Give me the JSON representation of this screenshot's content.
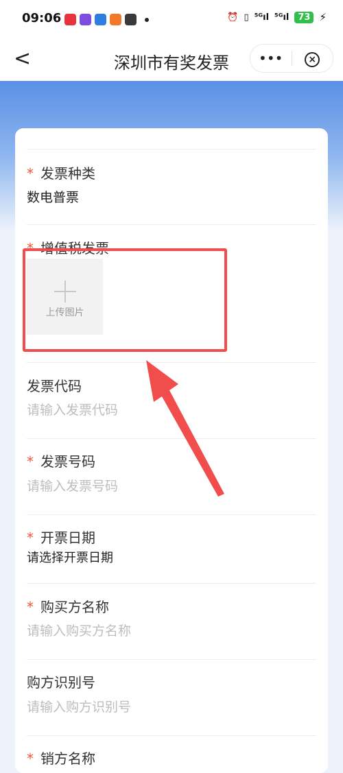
{
  "status_bar": {
    "time": "09:06",
    "signal1": "⁵ᴳıl",
    "signal2": "⁵ᴳıl",
    "battery": "73"
  },
  "nav": {
    "title": "深圳市有奖发票",
    "more_label": "•••",
    "close_label": "×"
  },
  "form": {
    "invoice_type": {
      "label": "发票种类",
      "value": "数电普票"
    },
    "vat_invoice": {
      "label": "增值税发票",
      "upload_label": "上传图片"
    },
    "invoice_code": {
      "label": "发票代码",
      "placeholder": "请输入发票代码"
    },
    "invoice_number": {
      "label": "发票号码",
      "placeholder": "请输入发票号码"
    },
    "issue_date": {
      "label": "开票日期",
      "placeholder": "请选择开票日期"
    },
    "buyer_name": {
      "label": "购买方名称",
      "placeholder": "请输入购买方名称"
    },
    "buyer_tax_id": {
      "label": "购方识别号",
      "placeholder": "请输入购方识别号"
    },
    "seller_name": {
      "label": "销方名称"
    },
    "required_mark": "*"
  },
  "colors": {
    "accent_red": "#f24d4d",
    "required": "#f0553b",
    "header_blue": "#5a90e6"
  }
}
